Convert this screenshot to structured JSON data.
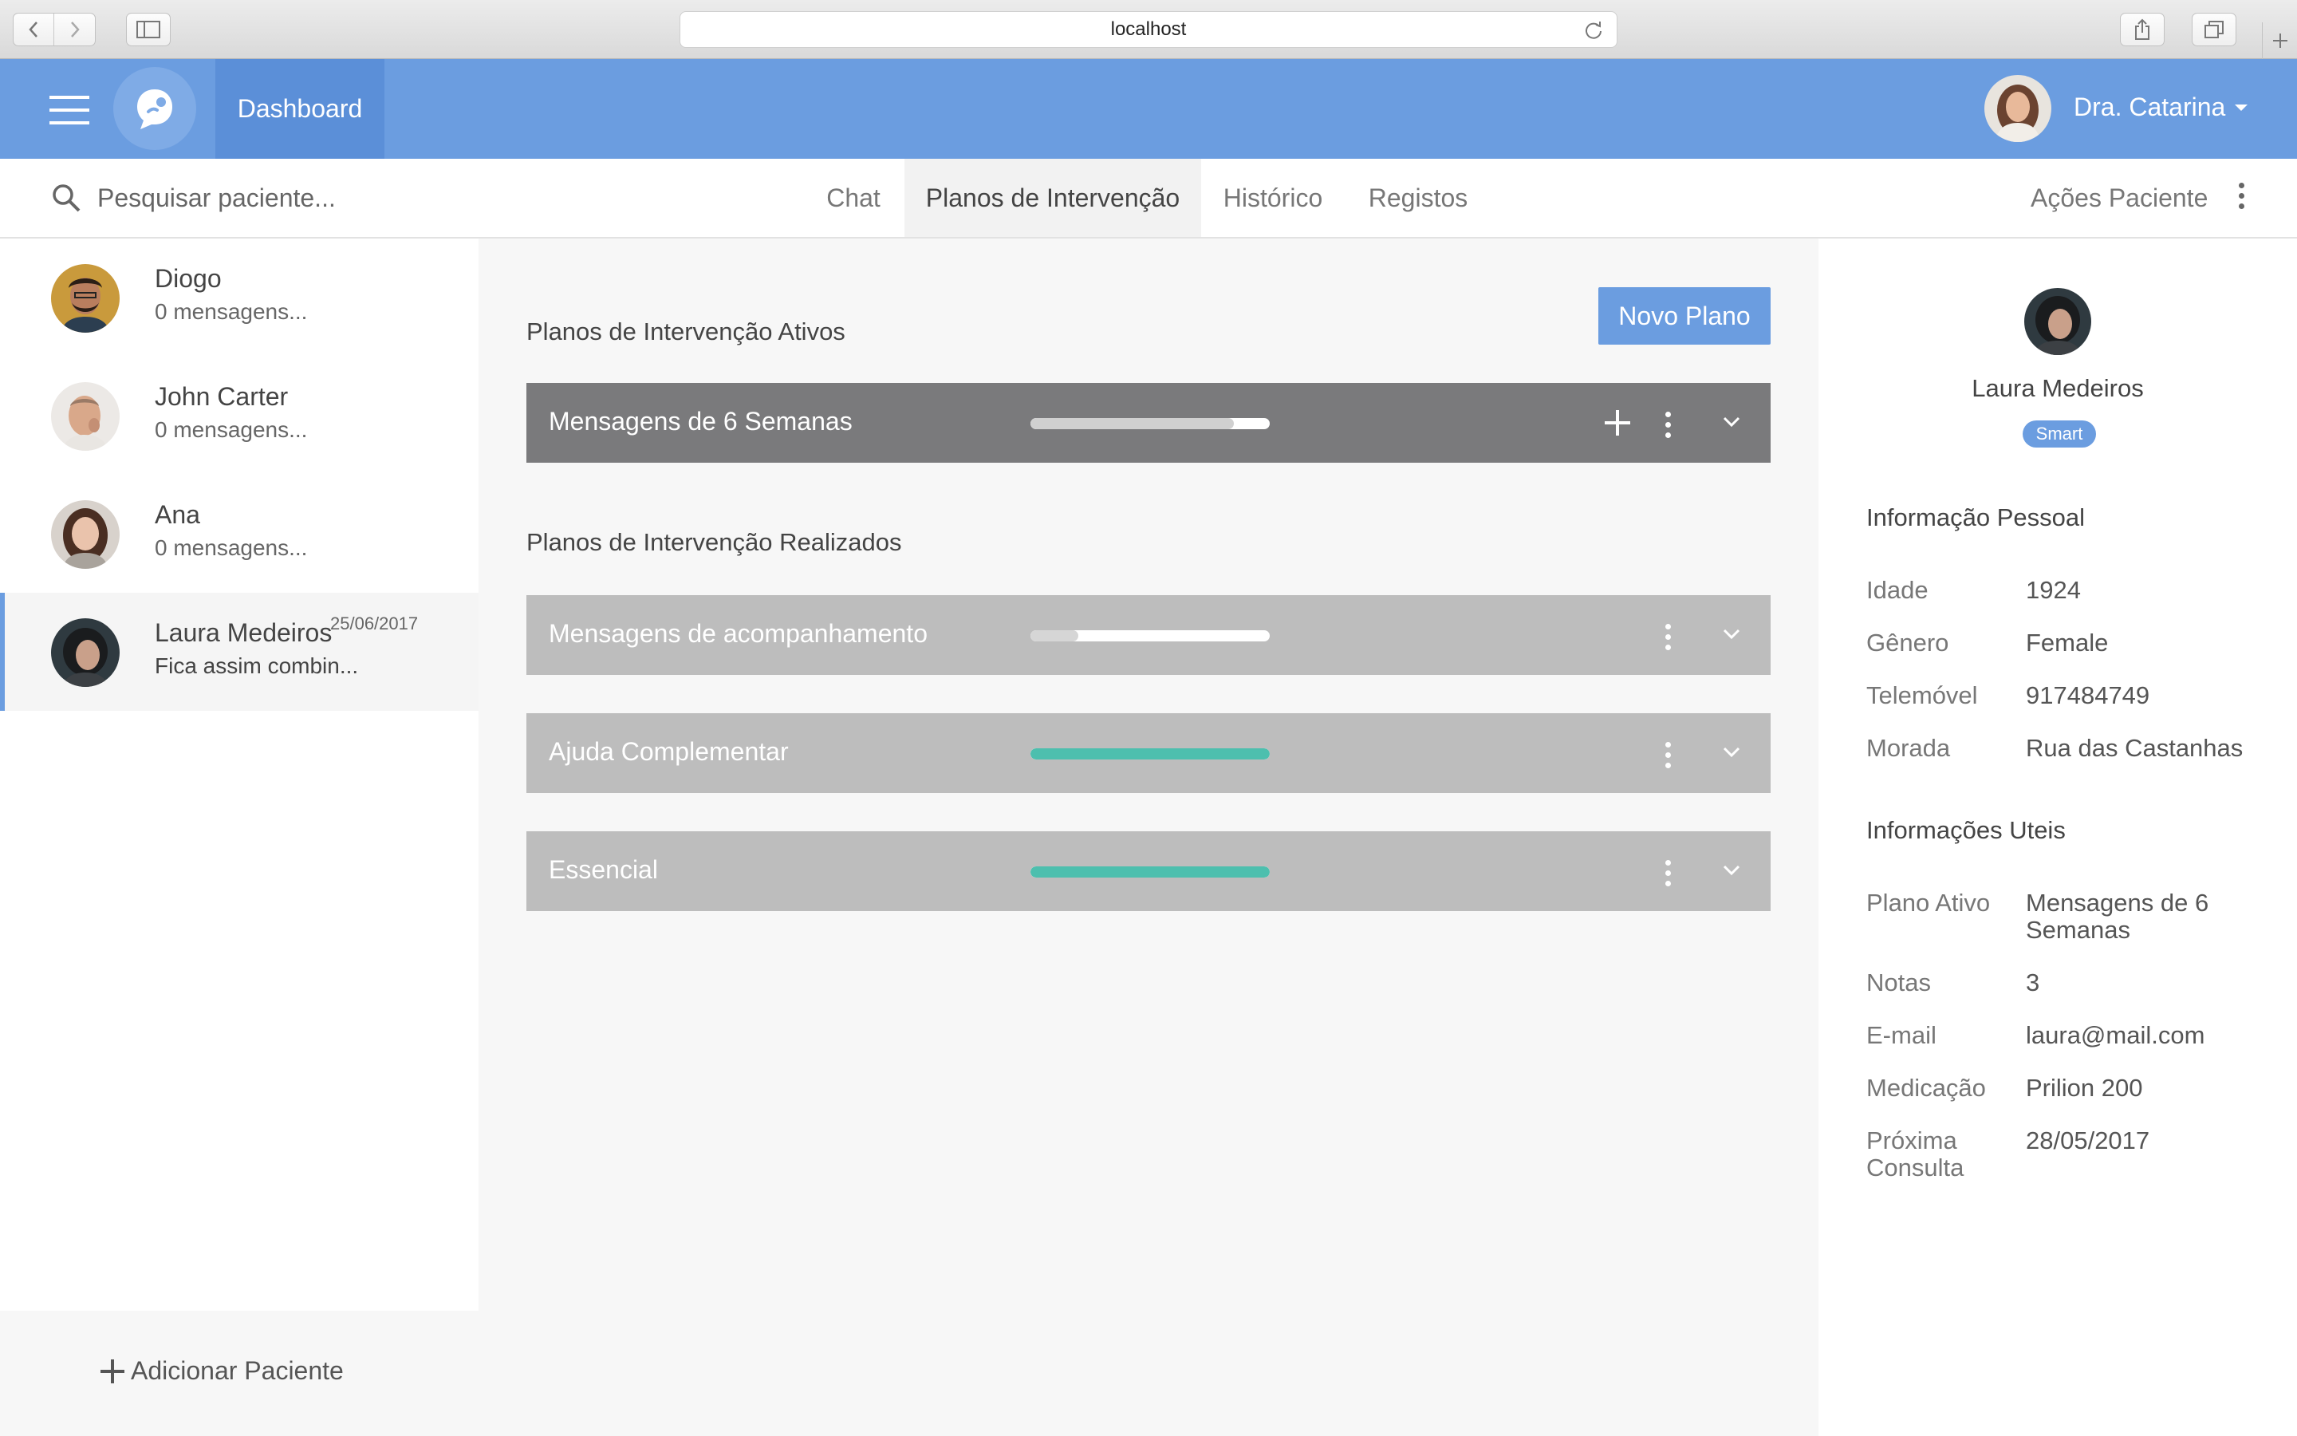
{
  "browser": {
    "url": "localhost"
  },
  "header": {
    "dashboard_label": "Dashboard",
    "user_name": "Dra. Catarina"
  },
  "toolbar": {
    "search_placeholder": "Pesquisar paciente...",
    "tabs": [
      {
        "label": "Chat",
        "active": false
      },
      {
        "label": "Planos de Intervenção",
        "active": true
      },
      {
        "label": "Histórico",
        "active": false
      },
      {
        "label": "Registos",
        "active": false
      }
    ],
    "actions_label": "Ações Paciente"
  },
  "patients": [
    {
      "name": "Diogo",
      "message": "0 mensagens...",
      "date": "",
      "selected": false
    },
    {
      "name": "John Carter",
      "message": "0 mensagens...",
      "date": "",
      "selected": false
    },
    {
      "name": "Ana",
      "message": "0 mensagens...",
      "date": "",
      "selected": false
    },
    {
      "name": "Laura Medeiros",
      "message": "Fica assim combin...",
      "date": "25/06/2017",
      "selected": true
    }
  ],
  "add_patient_label": "Adicionar Paciente",
  "main": {
    "active_title": "Planos de Intervenção Ativos",
    "new_plan_label": "Novo Plano",
    "active_plans": [
      {
        "title": "Mensagens de 6 Semanas",
        "progress": 0.85,
        "bar_color": "#d0d0d0"
      }
    ],
    "done_title": "Planos de Intervenção Realizados",
    "done_plans": [
      {
        "title": "Mensagens de acompanhamento",
        "progress": 0.2,
        "bar_color": "#d6d6d6"
      },
      {
        "title": "Ajuda Complementar",
        "progress": 1.0,
        "bar_color": "#4dbfae"
      },
      {
        "title": "Essencial",
        "progress": 1.0,
        "bar_color": "#4dbfae"
      }
    ]
  },
  "profile": {
    "name": "Laura Medeiros",
    "badge": "Smart",
    "personal_title": "Informação Pessoal",
    "personal": [
      {
        "label": "Idade",
        "value": "1924"
      },
      {
        "label": "Gênero",
        "value": "Female"
      },
      {
        "label": "Telemóvel",
        "value": "917484749"
      },
      {
        "label": "Morada",
        "value": "Rua das Castanhas"
      }
    ],
    "useful_title": "Informações Uteis",
    "useful": [
      {
        "label": "Plano Ativo",
        "value": "Mensagens de 6 Semanas"
      },
      {
        "label": "Notas",
        "value": "3"
      },
      {
        "label": "E-mail",
        "value": "laura@mail.com"
      },
      {
        "label": "Medicação",
        "value": "Prilion 200"
      },
      {
        "label": "Próxima Consulta",
        "value": "28/05/2017"
      }
    ]
  },
  "colors": {
    "brand": "#6b9de0",
    "brand_dark": "#5b8fd8",
    "complete": "#4dbfae"
  }
}
